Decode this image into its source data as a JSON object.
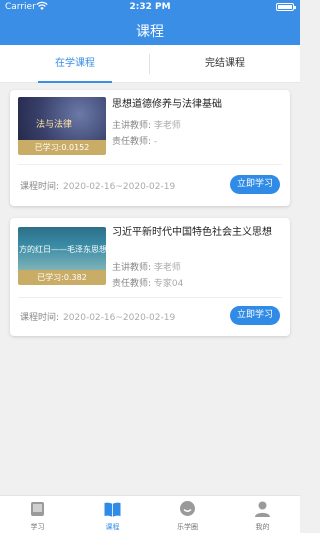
{
  "status_bar": {
    "carrier": "Carrier",
    "time": "2:32 PM"
  },
  "header": {
    "title": "课程"
  },
  "tabs": [
    {
      "label": "在学课程",
      "active": true
    },
    {
      "label": "完结课程",
      "active": false
    }
  ],
  "courses": [
    {
      "title": "思想道德修养与法律基础",
      "thumb_text": "法与法律",
      "progress_label": "已学习:0.0152",
      "teacher_label": "主讲教师:",
      "teacher": "李老师",
      "responsible_label": "责任教师:",
      "responsible": "-",
      "time_label": "课程时间:",
      "time": "2020-02-16~2020-02-19",
      "button": "立即学习"
    },
    {
      "title": "习近平新时代中国特色社会主义思想",
      "thumb_text": "方的红日——毛泽东思想",
      "progress_label": "已学习:0.382",
      "teacher_label": "主讲教师:",
      "teacher": "李老师",
      "responsible_label": "责任教师:",
      "responsible": "专家04",
      "time_label": "课程时间:",
      "time": "2020-02-16~2020-02-19",
      "button": "立即学习"
    }
  ],
  "tabbar": [
    {
      "label": "学习",
      "icon": "study-icon",
      "active": false
    },
    {
      "label": "课程",
      "icon": "book-icon",
      "active": true
    },
    {
      "label": "乐学圈",
      "icon": "chat-icon",
      "active": false
    },
    {
      "label": "我的",
      "icon": "profile-icon",
      "active": false
    }
  ],
  "colors": {
    "primary": "#3a8ee6",
    "button": "#2f8be6",
    "progress_band": "#c9ad67"
  }
}
